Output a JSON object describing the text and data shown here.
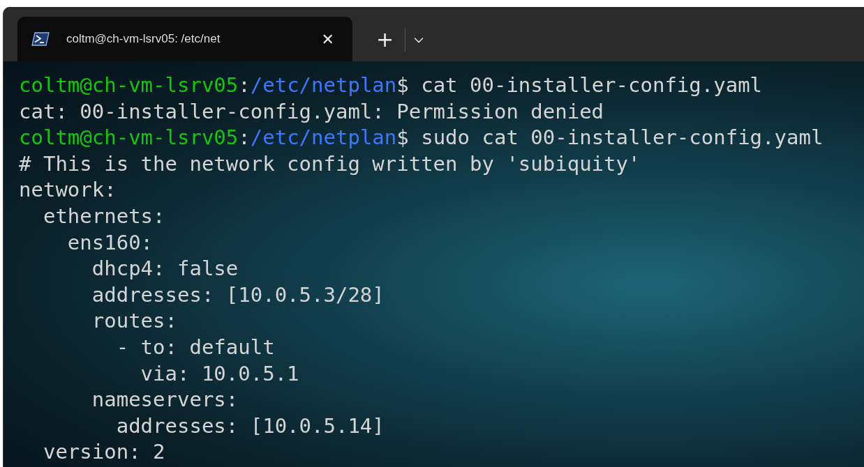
{
  "tabs": [
    {
      "title": "coltm@ch-vm-lsrv05: /etc/net",
      "selected": true,
      "close": "✕"
    }
  ],
  "new_tab": "+",
  "terminal": {
    "lines": [
      {
        "kind": "prompt",
        "user": "coltm@ch-vm-lsrv05",
        "separator": ":",
        "path": "/etc/netplan",
        "symbol": "$",
        "command": " cat 00-installer-config.yaml"
      },
      {
        "kind": "output",
        "text": "cat: 00-installer-config.yaml: Permission denied"
      },
      {
        "kind": "prompt",
        "user": "coltm@ch-vm-lsrv05",
        "separator": ":",
        "path": "/etc/netplan",
        "symbol": "$",
        "command": " sudo cat 00-installer-config.yaml"
      },
      {
        "kind": "output",
        "text": "# This is the network config written by 'subiquity'"
      },
      {
        "kind": "output",
        "text": "network:"
      },
      {
        "kind": "output",
        "text": "  ethernets:"
      },
      {
        "kind": "output",
        "text": "    ens160:"
      },
      {
        "kind": "output",
        "text": "      dhcp4: false"
      },
      {
        "kind": "output",
        "text": "      addresses: [10.0.5.3/28]"
      },
      {
        "kind": "output",
        "text": "      routes:"
      },
      {
        "kind": "output",
        "text": "        - to: default"
      },
      {
        "kind": "output",
        "text": "          via: 10.0.5.1"
      },
      {
        "kind": "output",
        "text": "      nameservers:"
      },
      {
        "kind": "output",
        "text": "        addresses: [10.0.5.14]"
      },
      {
        "kind": "output",
        "text": "  version: 2"
      }
    ]
  }
}
